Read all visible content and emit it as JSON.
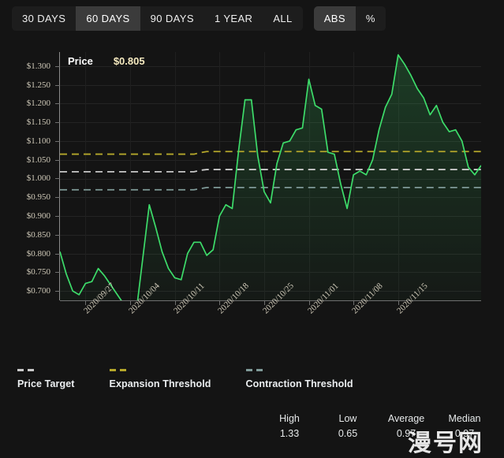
{
  "toolbar": {
    "range_buttons": [
      {
        "label": "30 DAYS",
        "active": false
      },
      {
        "label": "60 DAYS",
        "active": true
      },
      {
        "label": "90 DAYS",
        "active": false
      },
      {
        "label": "1 YEAR",
        "active": false
      },
      {
        "label": "ALL",
        "active": false
      }
    ],
    "mode_buttons": [
      {
        "label": "ABS",
        "active": true
      },
      {
        "label": "%",
        "active": false
      }
    ]
  },
  "header": {
    "series_label": "Price",
    "series_value": "$0.805"
  },
  "legend": [
    {
      "name": "price-target",
      "label": "Price Target",
      "color": "#c9c9c9"
    },
    {
      "name": "expansion-threshold",
      "label": "Expansion Threshold",
      "color": "#b5a72a"
    },
    {
      "name": "contraction-threshold",
      "label": "Contraction Threshold",
      "color": "#7f9a98"
    }
  ],
  "stats": [
    {
      "key": "High",
      "value": "1.33"
    },
    {
      "key": "Low",
      "value": "0.65"
    },
    {
      "key": "Average",
      "value": "0.97"
    },
    {
      "key": "Median",
      "value": "0.97"
    }
  ],
  "watermark": "漫号网",
  "chart_data": {
    "type": "line",
    "title": "Price",
    "xlabel": "",
    "ylabel": "",
    "grid": true,
    "legend_position": "bottom-left",
    "ylim": [
      0.675,
      1.3375
    ],
    "ytick_labels": [
      "$1.300",
      "$1.250",
      "$1.200",
      "$1.150",
      "$1.100",
      "$1.050",
      "$1.000",
      "$0.950",
      "$0.900",
      "$0.850",
      "$0.800",
      "$0.750",
      "$0.700"
    ],
    "ytick_values": [
      1.3,
      1.25,
      1.2,
      1.15,
      1.1,
      1.05,
      1.0,
      0.95,
      0.9,
      0.85,
      0.8,
      0.75,
      0.7
    ],
    "xtick_labels": [
      "2020/09/27",
      "2020/10/04",
      "2020/10/11",
      "2020/10/18",
      "2020/10/25",
      "2020/11/01",
      "2020/11/08",
      "2020/11/15"
    ],
    "xtick_indices": [
      4,
      11,
      18,
      25,
      32,
      39,
      46,
      53
    ],
    "colors": {
      "line": "#3ddc6a",
      "area_top": "rgba(61,220,106,0.20)",
      "area_bottom": "rgba(61,220,106,0.02)",
      "price_target": "#c9c9c9",
      "expansion_threshold": "#b5a72a",
      "contraction_threshold": "#7f9a98",
      "background": "#141414",
      "plot_background": "#1a1a1a",
      "axis": "#8a8a8a",
      "grid": "#242424",
      "tick_text": "#cfc9b8"
    },
    "series": [
      {
        "name": "Price",
        "values": [
          0.805,
          0.745,
          0.7,
          0.69,
          0.72,
          0.725,
          0.76,
          0.74,
          0.715,
          0.69,
          0.665,
          0.65,
          0.65,
          0.79,
          0.93,
          0.87,
          0.805,
          0.76,
          0.735,
          0.73,
          0.8,
          0.83,
          0.83,
          0.795,
          0.81,
          0.9,
          0.93,
          0.92,
          1.075,
          1.21,
          1.21,
          1.06,
          0.965,
          0.935,
          1.04,
          1.095,
          1.1,
          1.13,
          1.135,
          1.265,
          1.195,
          1.185,
          1.07,
          1.065,
          0.985,
          0.92,
          1.01,
          1.02,
          1.01,
          1.05,
          1.13,
          1.19,
          1.225,
          1.33,
          1.305,
          1.275,
          1.24,
          1.215,
          1.17,
          1.195,
          1.15,
          1.125,
          1.13,
          1.1,
          1.03,
          1.01,
          1.035
        ]
      },
      {
        "name": "Price Target",
        "style": "dashed",
        "values": [
          1.018,
          1.018,
          1.018,
          1.018,
          1.018,
          1.018,
          1.018,
          1.018,
          1.018,
          1.018,
          1.018,
          1.018,
          1.018,
          1.018,
          1.018,
          1.018,
          1.018,
          1.018,
          1.018,
          1.018,
          1.018,
          1.018,
          1.022,
          1.024,
          1.024,
          1.024,
          1.024,
          1.024,
          1.024,
          1.024,
          1.024,
          1.024,
          1.024,
          1.024,
          1.024,
          1.024,
          1.024,
          1.024,
          1.024,
          1.024,
          1.024,
          1.024,
          1.024,
          1.024,
          1.024,
          1.024,
          1.024,
          1.024,
          1.024,
          1.024,
          1.024,
          1.024,
          1.024,
          1.024,
          1.024,
          1.024,
          1.024,
          1.024,
          1.024,
          1.024,
          1.024,
          1.024,
          1.024,
          1.024,
          1.024,
          1.024,
          1.024
        ]
      },
      {
        "name": "Expansion Threshold",
        "style": "dashed",
        "values": [
          1.065,
          1.065,
          1.065,
          1.065,
          1.065,
          1.065,
          1.065,
          1.065,
          1.065,
          1.065,
          1.065,
          1.065,
          1.065,
          1.065,
          1.065,
          1.065,
          1.065,
          1.065,
          1.065,
          1.065,
          1.065,
          1.065,
          1.069,
          1.072,
          1.072,
          1.072,
          1.072,
          1.072,
          1.072,
          1.072,
          1.072,
          1.072,
          1.072,
          1.072,
          1.072,
          1.072,
          1.072,
          1.072,
          1.072,
          1.072,
          1.072,
          1.072,
          1.072,
          1.072,
          1.072,
          1.072,
          1.072,
          1.072,
          1.072,
          1.072,
          1.072,
          1.072,
          1.072,
          1.072,
          1.072,
          1.072,
          1.072,
          1.072,
          1.072,
          1.072,
          1.072,
          1.072,
          1.072,
          1.072,
          1.072,
          1.072,
          1.072
        ]
      },
      {
        "name": "Contraction Threshold",
        "style": "dashed",
        "values": [
          0.97,
          0.97,
          0.97,
          0.97,
          0.97,
          0.97,
          0.97,
          0.97,
          0.97,
          0.97,
          0.97,
          0.97,
          0.97,
          0.97,
          0.97,
          0.97,
          0.97,
          0.97,
          0.97,
          0.97,
          0.97,
          0.97,
          0.973,
          0.976,
          0.976,
          0.976,
          0.976,
          0.976,
          0.976,
          0.976,
          0.976,
          0.976,
          0.976,
          0.976,
          0.976,
          0.976,
          0.976,
          0.976,
          0.976,
          0.976,
          0.976,
          0.976,
          0.976,
          0.976,
          0.976,
          0.976,
          0.976,
          0.976,
          0.976,
          0.976,
          0.976,
          0.976,
          0.976,
          0.976,
          0.976,
          0.976,
          0.976,
          0.976,
          0.976,
          0.976,
          0.976,
          0.976,
          0.976,
          0.976,
          0.976,
          0.976,
          0.976
        ]
      }
    ]
  }
}
